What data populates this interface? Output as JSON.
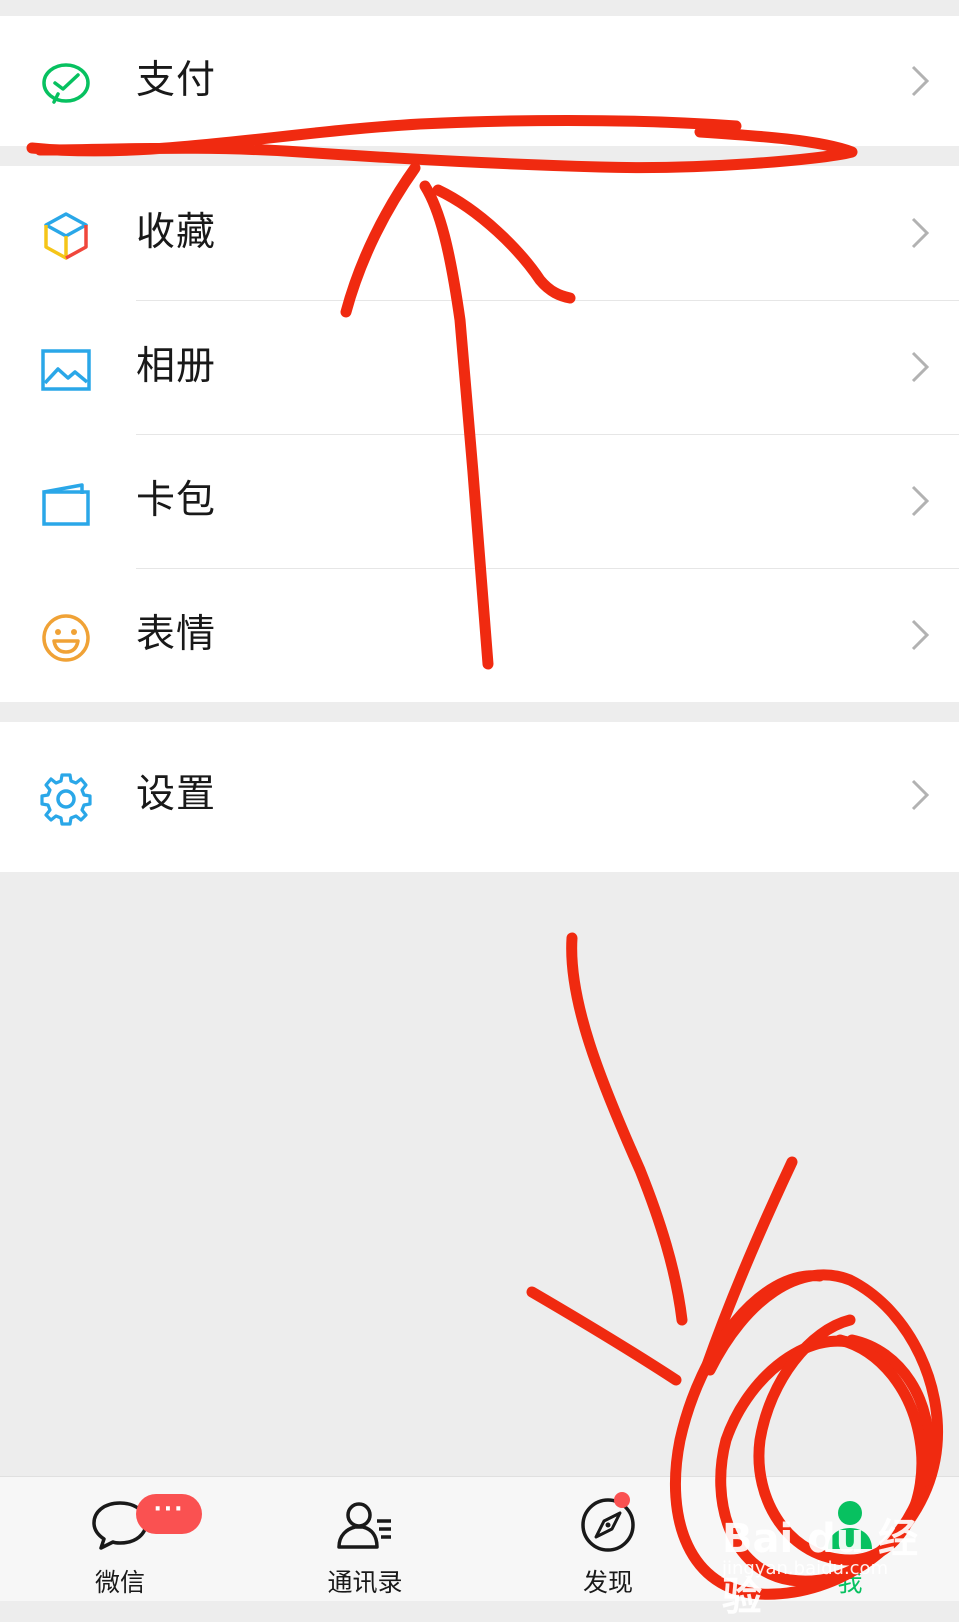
{
  "menu": {
    "pay": {
      "label": "支付",
      "icon": "wechat-pay-icon"
    },
    "group": [
      {
        "label": "收藏",
        "icon": "favorites-cube-icon"
      },
      {
        "label": "相册",
        "icon": "album-picture-icon"
      },
      {
        "label": "卡包",
        "icon": "card-wallet-icon"
      },
      {
        "label": "表情",
        "icon": "sticker-smile-icon"
      }
    ],
    "settings": {
      "label": "设置",
      "icon": "gear-icon"
    }
  },
  "tabbar": {
    "tabs": [
      {
        "label": "微信",
        "icon": "chat-bubble-icon"
      },
      {
        "label": "通讯录",
        "icon": "contacts-icon"
      },
      {
        "label": "发现",
        "icon": "compass-icon"
      },
      {
        "label": "我",
        "icon": "me-person-icon",
        "active": true
      }
    ],
    "chat_badge": "···"
  },
  "watermark": {
    "logo": "Bai du 经验",
    "url": "jingyan.baidu.com"
  },
  "colors": {
    "accent": "#07c160",
    "badge": "#fa5151",
    "annotation": "#f02a10",
    "background": "#ededed"
  }
}
